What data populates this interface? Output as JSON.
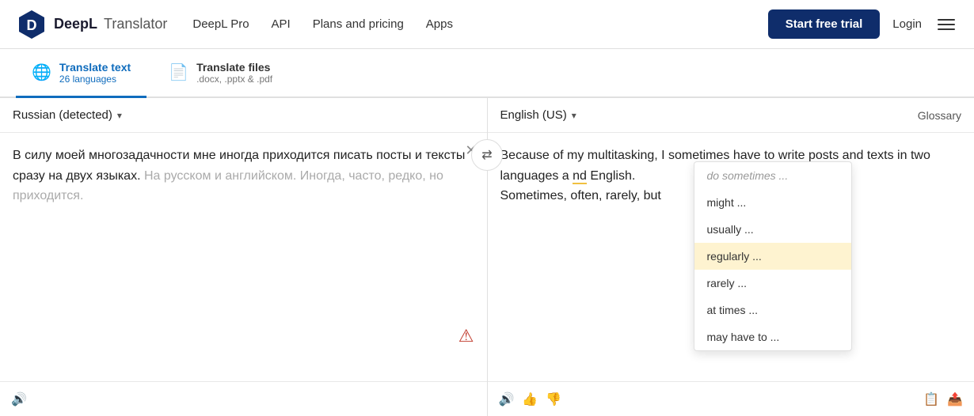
{
  "navbar": {
    "logo_brand": "DeepL",
    "logo_product": "Translator",
    "nav_links": [
      {
        "id": "deepl-pro",
        "label": "DeepL Pro"
      },
      {
        "id": "api",
        "label": "API"
      },
      {
        "id": "plans-pricing",
        "label": "Plans and pricing"
      },
      {
        "id": "apps",
        "label": "Apps"
      }
    ],
    "trial_button": "Start free trial",
    "login_button": "Login"
  },
  "tabs": [
    {
      "id": "translate-text",
      "icon": "🌐",
      "label": "Translate text",
      "sub": "26 languages",
      "active": true
    },
    {
      "id": "translate-files",
      "icon": "📄",
      "label": "Translate files",
      "sub": ".docx, .pptx & .pdf",
      "active": false
    }
  ],
  "source": {
    "lang": "Russian (detected)",
    "text_main": "В силу моей многозадачности мне иногда приходится писать посты и тексты сразу на двух языках.",
    "text_grey": "На русском и английском. Иногда, часто, редко, но приходится."
  },
  "target": {
    "lang": "English (US)",
    "glossary": "Glossary",
    "text_before": "Because of my multitasking, I sometimes have to write posts and texts in two languages a",
    "text_dropdown_anchor": "nd",
    "text_after": "English.",
    "text_line2": "Sometimes, often, rarely, but"
  },
  "dropdown": {
    "prefix": "do sometimes ...",
    "items": [
      {
        "id": "might",
        "label": "might ...",
        "highlighted": false
      },
      {
        "id": "usually",
        "label": "usually ...",
        "highlighted": false
      },
      {
        "id": "regularly",
        "label": "regularly ...",
        "highlighted": true
      },
      {
        "id": "rarely",
        "label": "rarely ...",
        "highlighted": false
      },
      {
        "id": "at-times",
        "label": "at times ...",
        "highlighted": false
      },
      {
        "id": "may-have-to",
        "label": "may have to ...",
        "highlighted": false
      }
    ]
  },
  "footer": {
    "speaker_icon": "🔊",
    "thumbup_icon": "👍",
    "thumbdown_icon": "👎",
    "copy_icon": "📋",
    "share_icon": "📤"
  }
}
